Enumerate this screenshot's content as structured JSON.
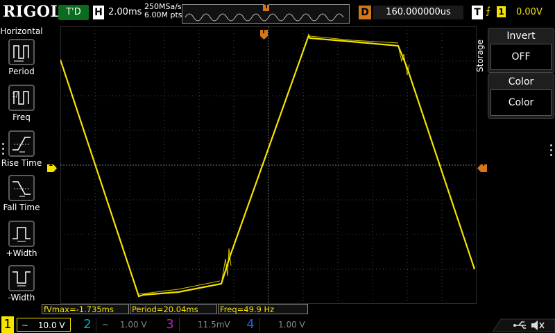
{
  "header": {
    "brand": "RIGOL",
    "run_status": "T'D",
    "timebase_label": "H",
    "timebase_value": "2.00ms",
    "sample_rate": "250MSa/s",
    "memory_depth": "6.00M pts",
    "trigger_position_marker": "T",
    "delay_label": "D",
    "delay_value": "160.000000us",
    "trigger_label": "T",
    "trigger_slope": "⨍",
    "trigger_source": "1",
    "trigger_level": "0.00V"
  },
  "left_menu": {
    "title": "Horizontal",
    "items": [
      {
        "label": "Period",
        "icon": "period-icon"
      },
      {
        "label": "Freq",
        "icon": "frequency-icon"
      },
      {
        "label": "Rise Time",
        "icon": "rise-time-icon"
      },
      {
        "label": "Fall Time",
        "icon": "fall-time-icon"
      },
      {
        "label": "+Width",
        "icon": "positive-width-icon"
      },
      {
        "label": "-Width",
        "icon": "negative-width-icon"
      }
    ]
  },
  "right_menu": {
    "section": "Storage",
    "items": [
      {
        "title": "Invert",
        "value": "OFF"
      },
      {
        "title": "Color",
        "value": "Color"
      }
    ]
  },
  "markers": {
    "trigger_top": "T",
    "ch1_level": "1",
    "trigger_level_right": "T"
  },
  "measurements": [
    "fVmax=-1.735ms",
    "Period=20.04ms",
    "Freq=49.9 Hz"
  ],
  "channels": [
    {
      "num": "1",
      "coupling": "~",
      "scale": "10.0 V",
      "color": "#f5e400",
      "active": true
    },
    {
      "num": "2",
      "coupling": "~",
      "scale": "1.00 V",
      "color": "#00b0b0",
      "active": false
    },
    {
      "num": "3",
      "coupling": "",
      "scale": "11.5mV",
      "color": "#c020c0",
      "active": false
    },
    {
      "num": "4",
      "coupling": "",
      "scale": "1.00 V",
      "color": "#2060e0",
      "active": false
    }
  ],
  "status_icons": [
    "usb-icon",
    "speaker-mute-icon"
  ],
  "colors": {
    "ch1": "#f5e400",
    "trigger": "#d4761a",
    "grid": "#4a4a4a",
    "running": "#0b6b1f"
  },
  "waveform": {
    "type": "trapezoid",
    "channel": "1",
    "period": "20.04ms",
    "frequency": "49.9 Hz"
  }
}
